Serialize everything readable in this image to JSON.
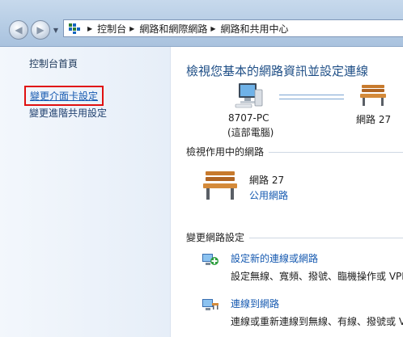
{
  "address_bar": {
    "breadcrumbs": [
      "控制台",
      "網路和網際網路",
      "網路和共用中心"
    ]
  },
  "sidebar": {
    "home": "控制台首頁",
    "items": [
      "變更介面卡設定",
      "變更進階共用設定"
    ]
  },
  "main": {
    "title": "檢視您基本的網路資訊並設定連線",
    "map": {
      "computer_name": "8707-PC",
      "computer_sub": "(這部電腦)",
      "network_name": "網路  27"
    },
    "active_section": "檢視作用中的網路",
    "active_network": {
      "name": "網路  27",
      "type": "公用網路"
    },
    "change_section": "變更網路設定",
    "tasks": [
      {
        "link": "設定新的連線或網路",
        "desc": "設定無線、寬頻、撥號、臨機操作或 VPN"
      },
      {
        "link": "連線到網路",
        "desc": "連線或重新連線到無線、有線、撥號或 V"
      }
    ]
  },
  "colors": {
    "link": "#1559b0",
    "title": "#1e4e86",
    "highlight_border": "#e01010"
  },
  "icons": {
    "nav": [
      "back-arrow-icon",
      "forward-arrow-icon",
      "recent-pages-dropdown-icon"
    ],
    "address": "control-panel-icon",
    "map": [
      "computer-icon",
      "bench-network-icon"
    ],
    "active": "bench-network-icon",
    "tasks": [
      "network-setup-icon",
      "connect-network-icon"
    ]
  }
}
